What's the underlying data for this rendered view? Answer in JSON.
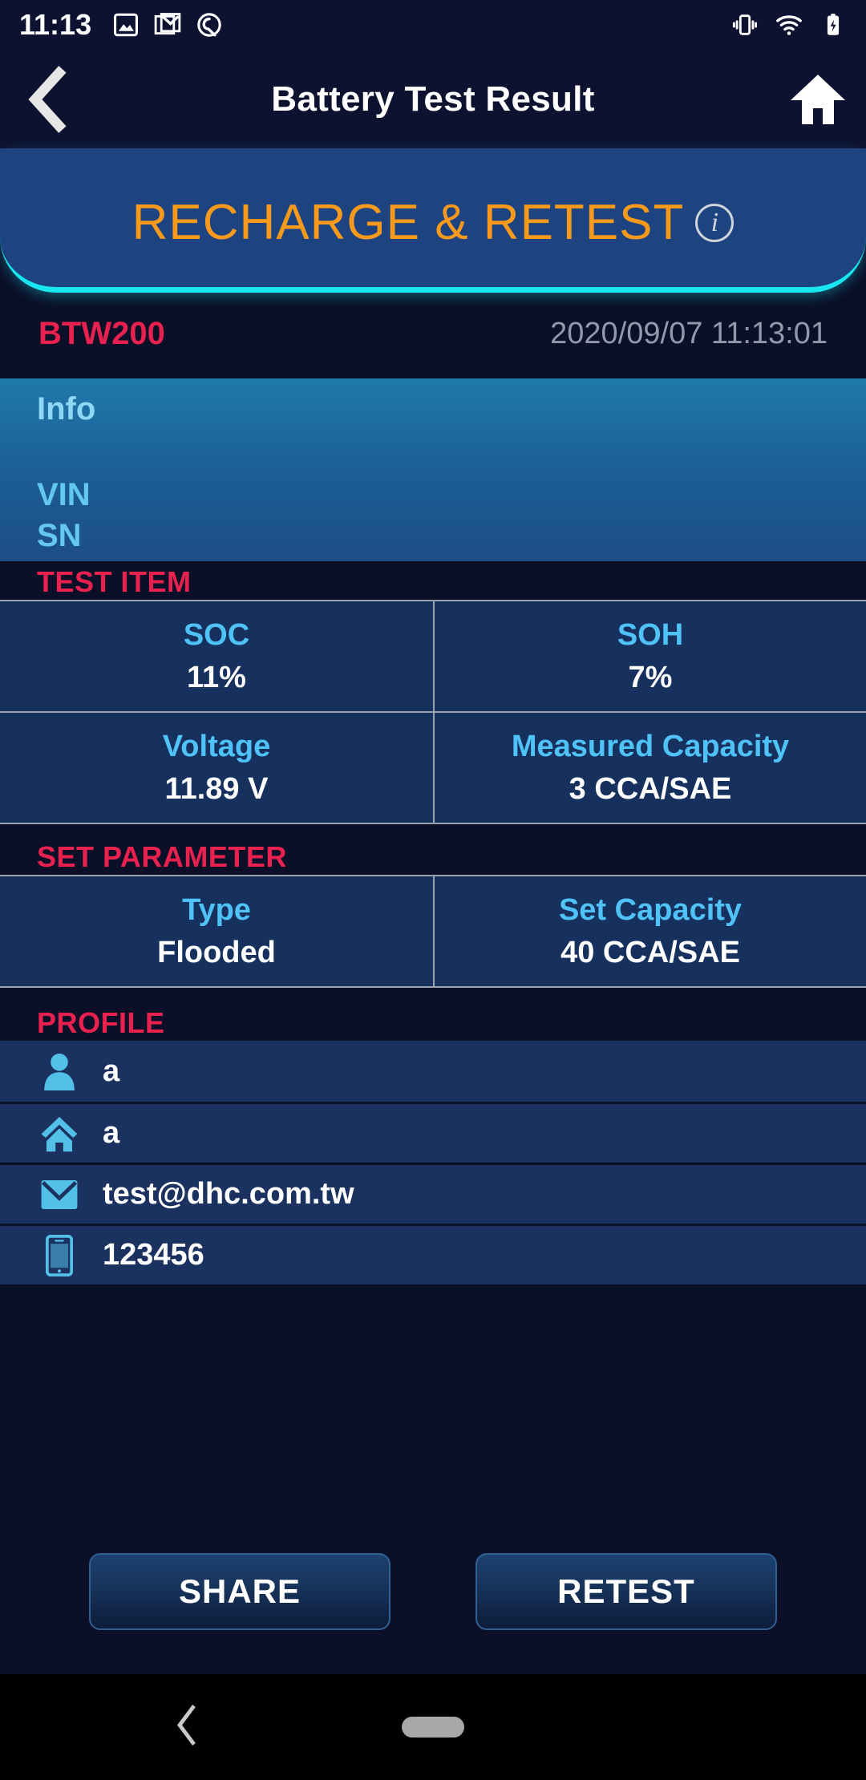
{
  "statusbar": {
    "time": "11:13",
    "left_icons": [
      "image-icon",
      "gmail-icon",
      "quick-settings-icon"
    ],
    "right_icons": [
      "vibrate-icon",
      "wifi-icon",
      "battery-charging-icon"
    ]
  },
  "appbar": {
    "title": "Battery Test Result",
    "back_icon": "chevron-left-icon",
    "home_icon": "home-icon"
  },
  "banner": {
    "label": "RECHARGE & RETEST",
    "info_glyph": "i",
    "text_color": "#f79a1b",
    "background_color": "#1d4380",
    "underline_color": "#19e6f0"
  },
  "device": {
    "model": "BTW200",
    "datetime": "2020/09/07 11:13:01",
    "model_color": "#e8214e"
  },
  "info": {
    "title": "Info",
    "vin_label": "VIN",
    "vin_value": "",
    "sn_label": "SN",
    "sn_value": ""
  },
  "test_item": {
    "header": "TEST ITEM",
    "rows": [
      [
        {
          "label": "SOC",
          "value": "11%"
        },
        {
          "label": "SOH",
          "value": "7%"
        }
      ],
      [
        {
          "label": "Voltage",
          "value": "11.89 V"
        },
        {
          "label": "Measured Capacity",
          "value": "3 CCA/SAE"
        }
      ]
    ]
  },
  "set_parameter": {
    "header": "SET PARAMETER",
    "rows": [
      [
        {
          "label": "Type",
          "value": "Flooded"
        },
        {
          "label": "Set Capacity",
          "value": "40 CCA/SAE"
        }
      ]
    ]
  },
  "profile": {
    "header": "PROFILE",
    "rows": [
      {
        "icon": "person-icon",
        "value": "a"
      },
      {
        "icon": "home-icon",
        "value": "a"
      },
      {
        "icon": "envelope-icon",
        "value": "test@dhc.com.tw"
      },
      {
        "icon": "mobile-phone-icon",
        "value": "123456"
      }
    ]
  },
  "actions": {
    "share": "SHARE",
    "retest": "RETEST"
  },
  "navbar": {
    "back_icon": "nav-back-icon",
    "home_pill": "nav-home-pill"
  }
}
